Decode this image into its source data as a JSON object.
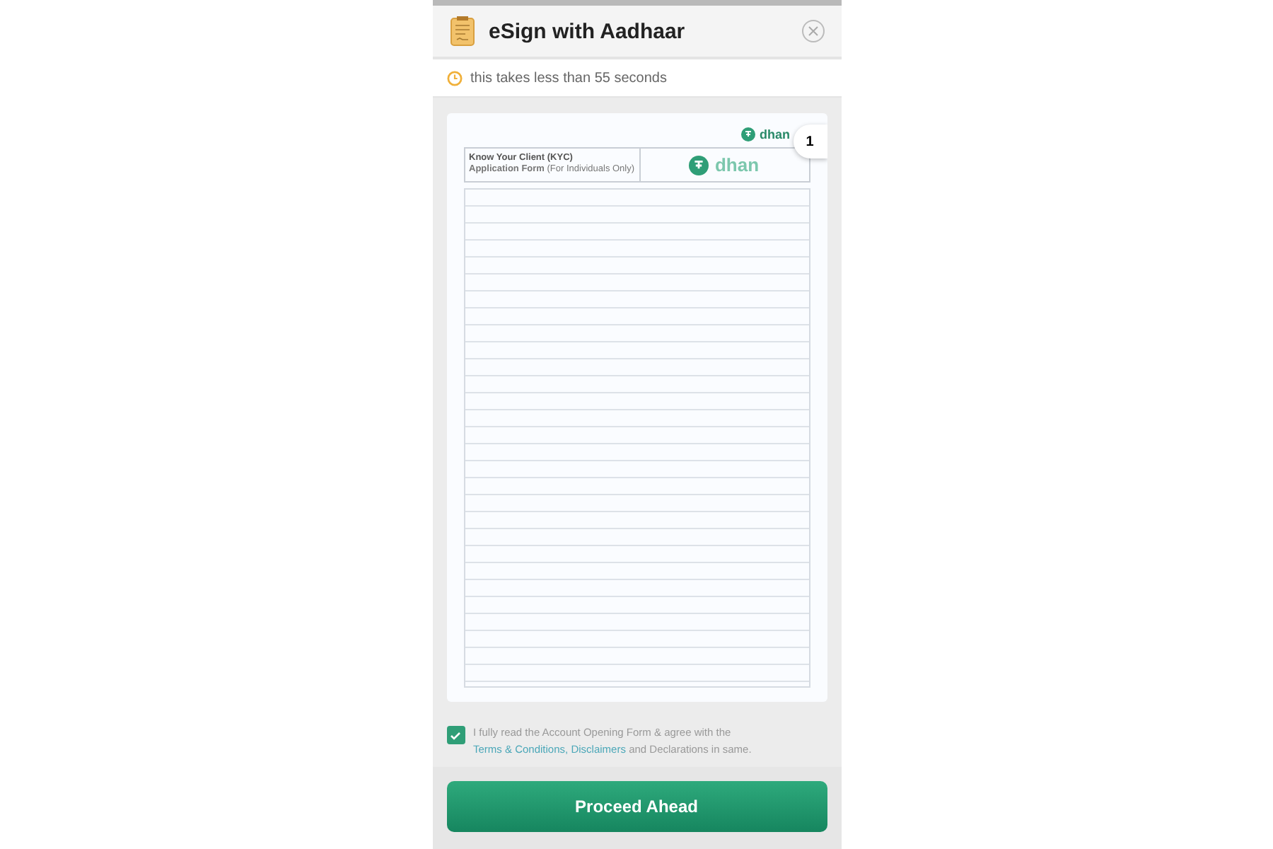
{
  "header": {
    "title": "eSign with Aadhaar"
  },
  "notice": "this takes less than 55 seconds",
  "document": {
    "brand_small": "dhan",
    "page_number": "1",
    "form_title": "Know Your Client (KYC)",
    "form_subtitle": "Application Form",
    "form_note": "(For Individuals Only)",
    "brand_large": "dhan"
  },
  "consent": {
    "checked": true,
    "text_before": "I fully read the Account Opening Form & agree with the",
    "link_terms": "Terms & Conditions,",
    "link_disclaimers": "Disclaimers",
    "text_after": "and Declarations in same."
  },
  "button": "Proceed Ahead"
}
